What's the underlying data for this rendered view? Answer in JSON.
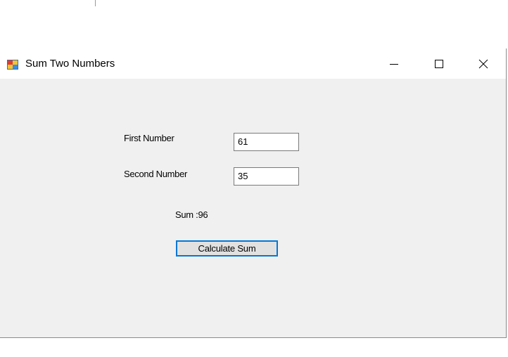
{
  "window": {
    "title": "Sum Two Numbers",
    "icon": "winforms-app-icon"
  },
  "caption_buttons": {
    "minimize_icon": "minimize-icon",
    "maximize_icon": "maximize-icon",
    "close_icon": "close-icon"
  },
  "form": {
    "first_label": "First Number",
    "first_value": "61",
    "second_label": "Second Number",
    "second_value": "35",
    "sum_text": "Sum :96",
    "calculate_label": "Calculate Sum"
  },
  "colors": {
    "titlebar": "#ffffff",
    "client_bg": "#f0f0f0",
    "focus_border": "#0078d7",
    "button_face": "#e1e1e1"
  }
}
